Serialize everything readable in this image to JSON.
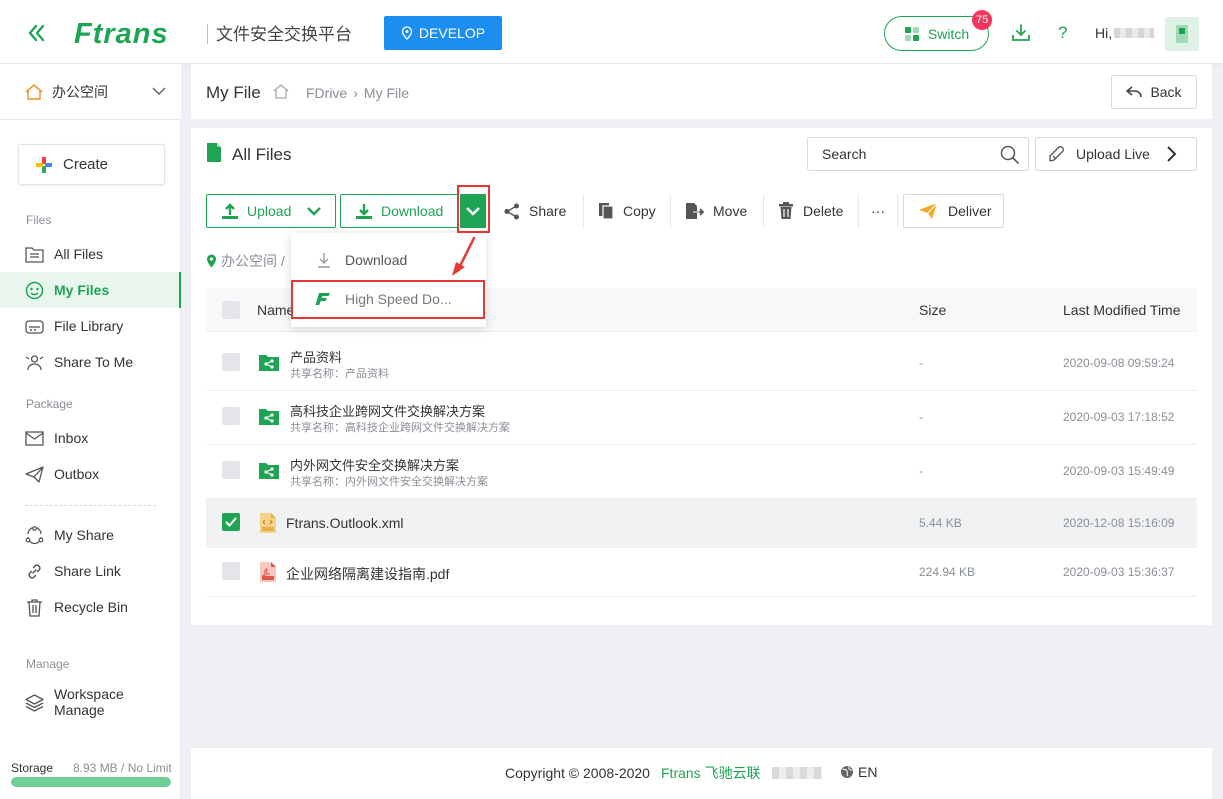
{
  "header": {
    "brand": "Ftrans",
    "app_title": "文件安全交换平台",
    "env_label": "DEVELOP",
    "switch_label": "Switch",
    "switch_badge": "75",
    "help_label": "?",
    "greeting": "Hi,",
    "accent": "#1fa454",
    "env_color": "#1b8ef0"
  },
  "sidebar": {
    "workspace": "办公空间",
    "create_label": "Create",
    "sections": {
      "files": "Files",
      "package": "Package",
      "manage": "Manage"
    },
    "items": [
      {
        "label": "All Files",
        "icon": "folder-list-icon"
      },
      {
        "label": "My Files",
        "icon": "smile-face-icon",
        "active": true
      },
      {
        "label": "File Library",
        "icon": "library-icon"
      },
      {
        "label": "Share To Me",
        "icon": "share-to-me-icon"
      },
      {
        "label": "Inbox",
        "icon": "mail-icon"
      },
      {
        "label": "Outbox",
        "icon": "paper-plane-icon"
      },
      {
        "label": "My Share",
        "icon": "my-share-icon"
      },
      {
        "label": "Share Link",
        "icon": "link-icon"
      },
      {
        "label": "Recycle Bin",
        "icon": "trash-icon"
      },
      {
        "label": "Workspace Manage",
        "icon": "layers-icon"
      }
    ],
    "storage_label": "Storage",
    "storage_value": "8.93 MB / No Limit",
    "storage_fraction": 1
  },
  "breadcrumb": {
    "title": "My File",
    "path": [
      "FDrive",
      "My File"
    ],
    "separator": "›",
    "back_label": "Back"
  },
  "main": {
    "title": "All Files",
    "search_placeholder": "Search",
    "upload_live_label": "Upload Live",
    "toolbar": {
      "upload": "Upload",
      "download": "Download",
      "share": "Share",
      "copy": "Copy",
      "move": "Move",
      "delete": "Delete",
      "more": "···",
      "deliver": "Deliver"
    },
    "location": "办公空间 /",
    "dropdown": {
      "download": "Download",
      "high_speed": "High Speed Do..."
    },
    "columns": {
      "name": "Name",
      "size": "Size",
      "modified": "Last Modified Time"
    },
    "rows": [
      {
        "name": "产品资料",
        "sub": "共享名称：产品资料",
        "size": "-",
        "time": "2020-09-08 09:59:24",
        "type": "shared-folder",
        "checked": false
      },
      {
        "name": "高科技企业跨网文件交换解决方案",
        "sub": "共享名称：高科技企业跨网文件交换解决方案",
        "size": "-",
        "time": "2020-09-03 17:18:52",
        "type": "shared-folder",
        "checked": false
      },
      {
        "name": "内外网文件安全交换解决方案",
        "sub": "共享名称：内外网文件安全交换解决方案",
        "size": "-",
        "time": "2020-09-03 15:49:49",
        "type": "shared-folder",
        "checked": false
      },
      {
        "name": "Ftrans.Outlook.xml",
        "sub": "",
        "size": "5.44 KB",
        "time": "2020-12-08 15:16:09",
        "type": "xml",
        "checked": true
      },
      {
        "name": "企业网络隔离建设指南.pdf",
        "sub": "",
        "size": "224.94 KB",
        "time": "2020-09-03 15:36:37",
        "type": "pdf",
        "checked": false
      }
    ]
  },
  "footer": {
    "copyright": "Copyright © 2008-2020",
    "brand": "Ftrans 飞驰云联",
    "language": "EN"
  }
}
